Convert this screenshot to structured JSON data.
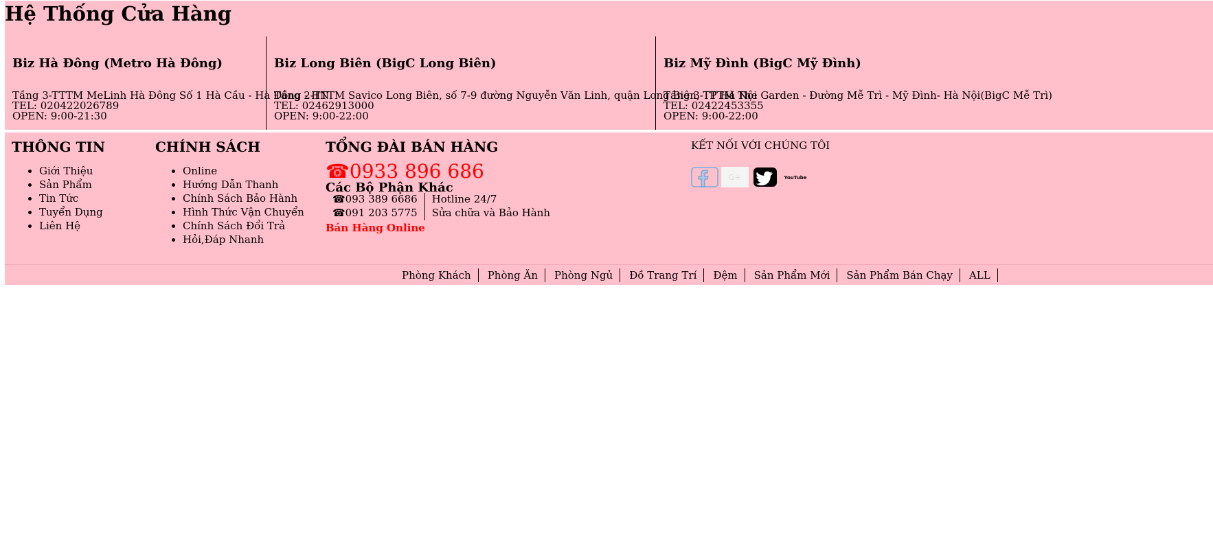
{
  "stores_section": {
    "title": "Hệ Thống Cửa Hàng",
    "stores": [
      {
        "name": "Biz Hà Đông (Metro Hà Đông)",
        "address": "Tầng 3-TTTM MeLinh Hà Đông Số 1 Hà Cầu - Hà Đông - HN",
        "tel": "TEL: 020422026789",
        "open": "OPEN: 9:00-21:30"
      },
      {
        "name": "Biz Long Biên (BigC Long Biên)",
        "address": "Tầng 2-TTTM Savico Long Biên, số 7-9 đường Nguyễn Văn Linh, quận Long Biên, TP Hà Nội",
        "tel": "TEL: 02462913000",
        "open": "OPEN: 9:00-22:00"
      },
      {
        "name": "Biz Mỹ Đình (BigC Mỹ Đình)",
        "address": "Tầng 3-TTTM The Garden - Đường Mễ Trì - Mỹ Đình- Hà Nội(BigC Mễ Trì)",
        "tel": "TEL: 02422453355",
        "open": "OPEN: 9:00-22:00"
      }
    ]
  },
  "footer": {
    "info": {
      "title": "THÔNG TIN",
      "items": [
        "Giới Thiệu",
        "Sản Phẩm",
        "Tin Tức",
        "Tuyển Dụng",
        "Liên Hệ"
      ]
    },
    "policy": {
      "title": "CHÍNH SÁCH",
      "items": [
        "Online",
        "Hướng Dẫn Thanh",
        "Chính Sách Bảo Hành",
        "Hình Thức Vận Chuyển",
        "Chính Sách Đổi Trả",
        "Hỏi,Đáp Nhanh"
      ]
    },
    "hotline": {
      "title": "TỔNG ĐÀI BÁN HÀNG",
      "main_number": "☎0933 896 686",
      "sub_title": "Các Bộ Phận Khác",
      "departments": [
        {
          "number": "☎093 389 6686",
          "label": "Hotline 24/7"
        },
        {
          "number": "☎091 203 5775",
          "label": "Sửa chữa và Bảo Hành"
        }
      ],
      "online_label": "Bán Hàng Online"
    },
    "connect": {
      "title": "KẾT NỐI VỚI CHÚNG TÔI",
      "icons": [
        "facebook-icon",
        "google-plus-icon",
        "twitter-icon",
        "youtube-icon"
      ],
      "youtube_text": "YouTube"
    }
  },
  "nav": [
    "Phòng Khách",
    "Phòng Ăn",
    "Phòng Ngủ",
    "Đồ Trang Trí",
    "Đệm",
    "Sản Phẩm Mới",
    "Sản Phẩm Bán Chạy",
    "ALL"
  ],
  "colors": {
    "background": "#ffc0cb",
    "accent_red": "#ff0000"
  }
}
